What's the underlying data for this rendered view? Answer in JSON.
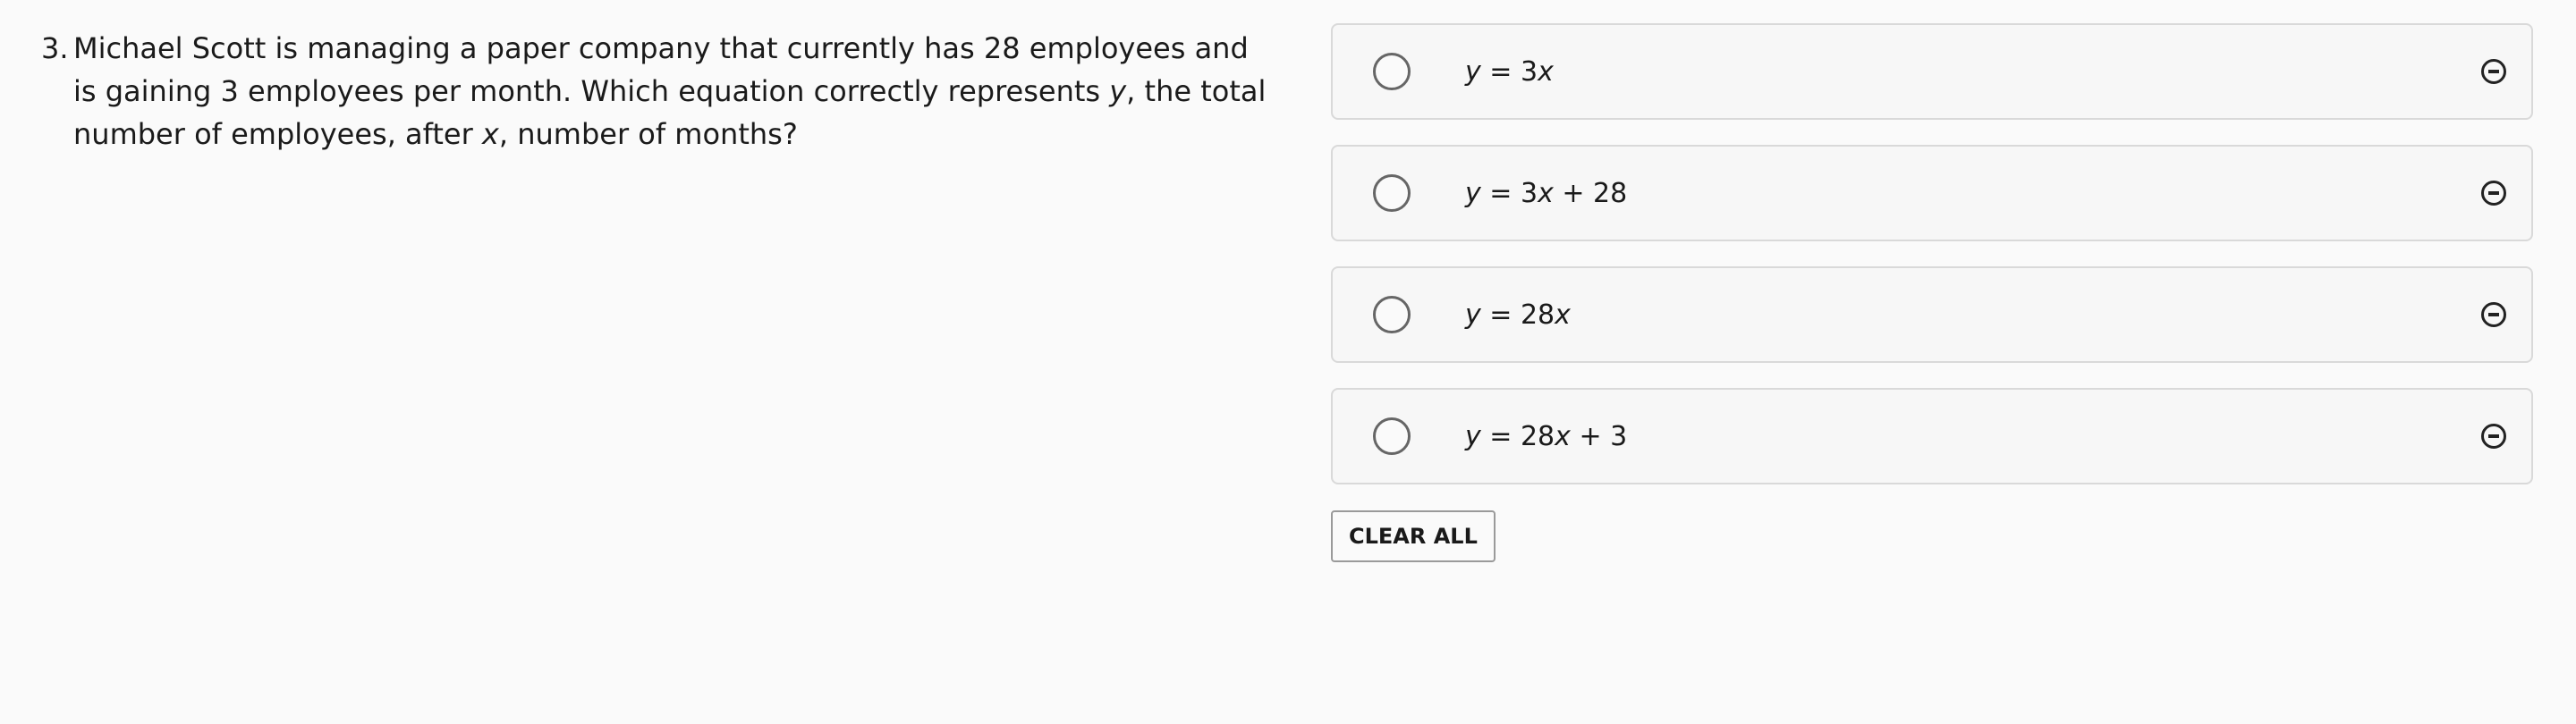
{
  "question": {
    "number": "3.",
    "text_part1": "Michael Scott is managing a paper company that currently has 28 employees and is gaining 3 employees per month. Which equation correctly represents ",
    "var_y": "y",
    "text_part2": ", the total number of employees, after ",
    "var_x": "x",
    "text_part3": ", number of months?"
  },
  "choices": [
    {
      "y": "y",
      "eq": " = 3",
      "x": "x",
      "tail": ""
    },
    {
      "y": "y",
      "eq": " = 3",
      "x": "x",
      "tail": " + 28"
    },
    {
      "y": "y",
      "eq": " = 28",
      "x": "x",
      "tail": ""
    },
    {
      "y": "y",
      "eq": " = 28",
      "x": "x",
      "tail": " + 3"
    }
  ],
  "icons": {
    "radio": "radio-empty-icon",
    "eliminate": "minus-circle-icon"
  },
  "actions": {
    "clear_all": "CLEAR ALL"
  }
}
